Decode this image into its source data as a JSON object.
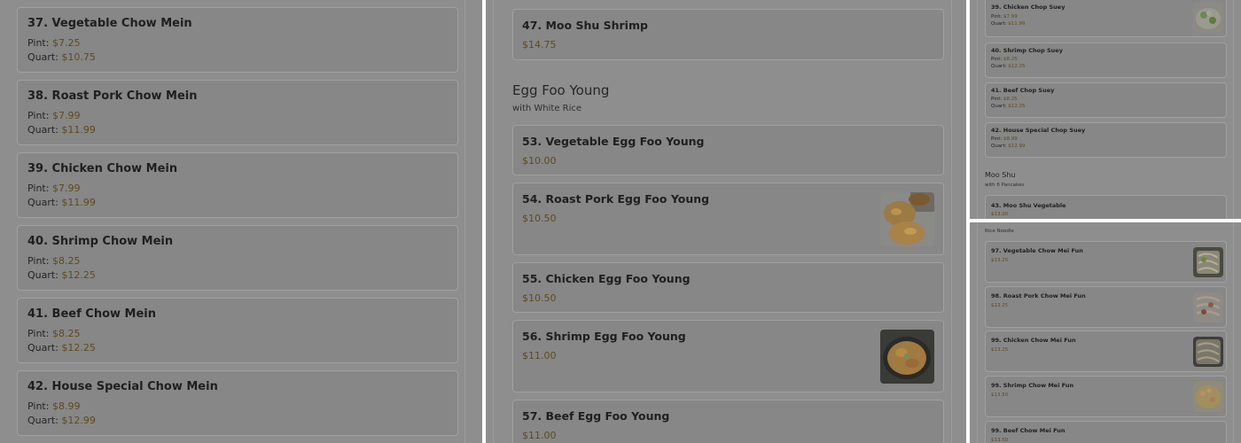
{
  "panel1": {
    "items": [
      {
        "name": "37. Vegetable Chow Mein",
        "pint_label": "Pint:",
        "pint": "$7.25",
        "quart_label": "Quart:",
        "quart": "$10.75"
      },
      {
        "name": "38. Roast Pork Chow Mein",
        "pint_label": "Pint:",
        "pint": "$7.99",
        "quart_label": "Quart:",
        "quart": "$11.99"
      },
      {
        "name": "39. Chicken Chow Mein",
        "pint_label": "Pint:",
        "pint": "$7.99",
        "quart_label": "Quart:",
        "quart": "$11.99"
      },
      {
        "name": "40. Shrimp Chow Mein",
        "pint_label": "Pint:",
        "pint": "$8.25",
        "quart_label": "Quart:",
        "quart": "$12.25"
      },
      {
        "name": "41. Beef Chow Mein",
        "pint_label": "Pint:",
        "pint": "$8.25",
        "quart_label": "Quart:",
        "quart": "$12.25"
      },
      {
        "name": "42. House Special Chow Mein",
        "pint_label": "Pint:",
        "pint": "$8.99",
        "quart_label": "Quart:",
        "quart": "$12.99"
      }
    ]
  },
  "panel2": {
    "top_item": {
      "name": "47. Moo Shu Shrimp",
      "price": "$14.75"
    },
    "section": {
      "title": "Egg Foo Young",
      "subtitle": "with White Rice"
    },
    "items": [
      {
        "name": "53. Vegetable Egg Foo Young",
        "price": "$10.00"
      },
      {
        "name": "54. Roast Pork Egg Foo Young",
        "price": "$10.50"
      },
      {
        "name": "55. Chicken Egg Foo Young",
        "price": "$10.50"
      },
      {
        "name": "56. Shrimp Egg Foo Young",
        "price": "$11.00"
      },
      {
        "name": "57. Beef Egg Foo Young",
        "price": "$11.00"
      }
    ]
  },
  "panel3": {
    "items": [
      {
        "name": "39. Chicken Chop Suey",
        "pint_label": "Pint:",
        "pint": "$7.99",
        "quart_label": "Quart:",
        "quart": "$11.99"
      },
      {
        "name": "40. Shrimp Chop Suey",
        "pint_label": "Pint:",
        "pint": "$8.25",
        "quart_label": "Quart:",
        "quart": "$12.25"
      },
      {
        "name": "41. Beef Chop Suey",
        "pint_label": "Pint:",
        "pint": "$8.25",
        "quart_label": "Quart:",
        "quart": "$12.25"
      },
      {
        "name": "42. House Special Chop Suey",
        "pint_label": "Pint:",
        "pint": "$8.99",
        "quart_label": "Quart:",
        "quart": "$12.99"
      }
    ],
    "section": {
      "title": "Moo Shu",
      "subtitle": "with 6 Pancakes"
    },
    "section_item": {
      "name": "43. Moo Shu Vegetable",
      "price": "$13.00"
    }
  },
  "panel4": {
    "section_subtitle": "Rice Noodle",
    "items": [
      {
        "name": "97. Vegetable Chow Mei Fun",
        "price": "$13.25"
      },
      {
        "name": "98. Roast Pork Chow Mei Fun",
        "price": "$13.25"
      },
      {
        "name": "99. Chicken Chow Mei Fun",
        "price": "$13.25"
      },
      {
        "name": "99. Shrimp Chow Mei Fun",
        "price": "$13.50"
      },
      {
        "name": "99. Beef Chow Mei Fun",
        "price": "$13.50"
      }
    ]
  }
}
